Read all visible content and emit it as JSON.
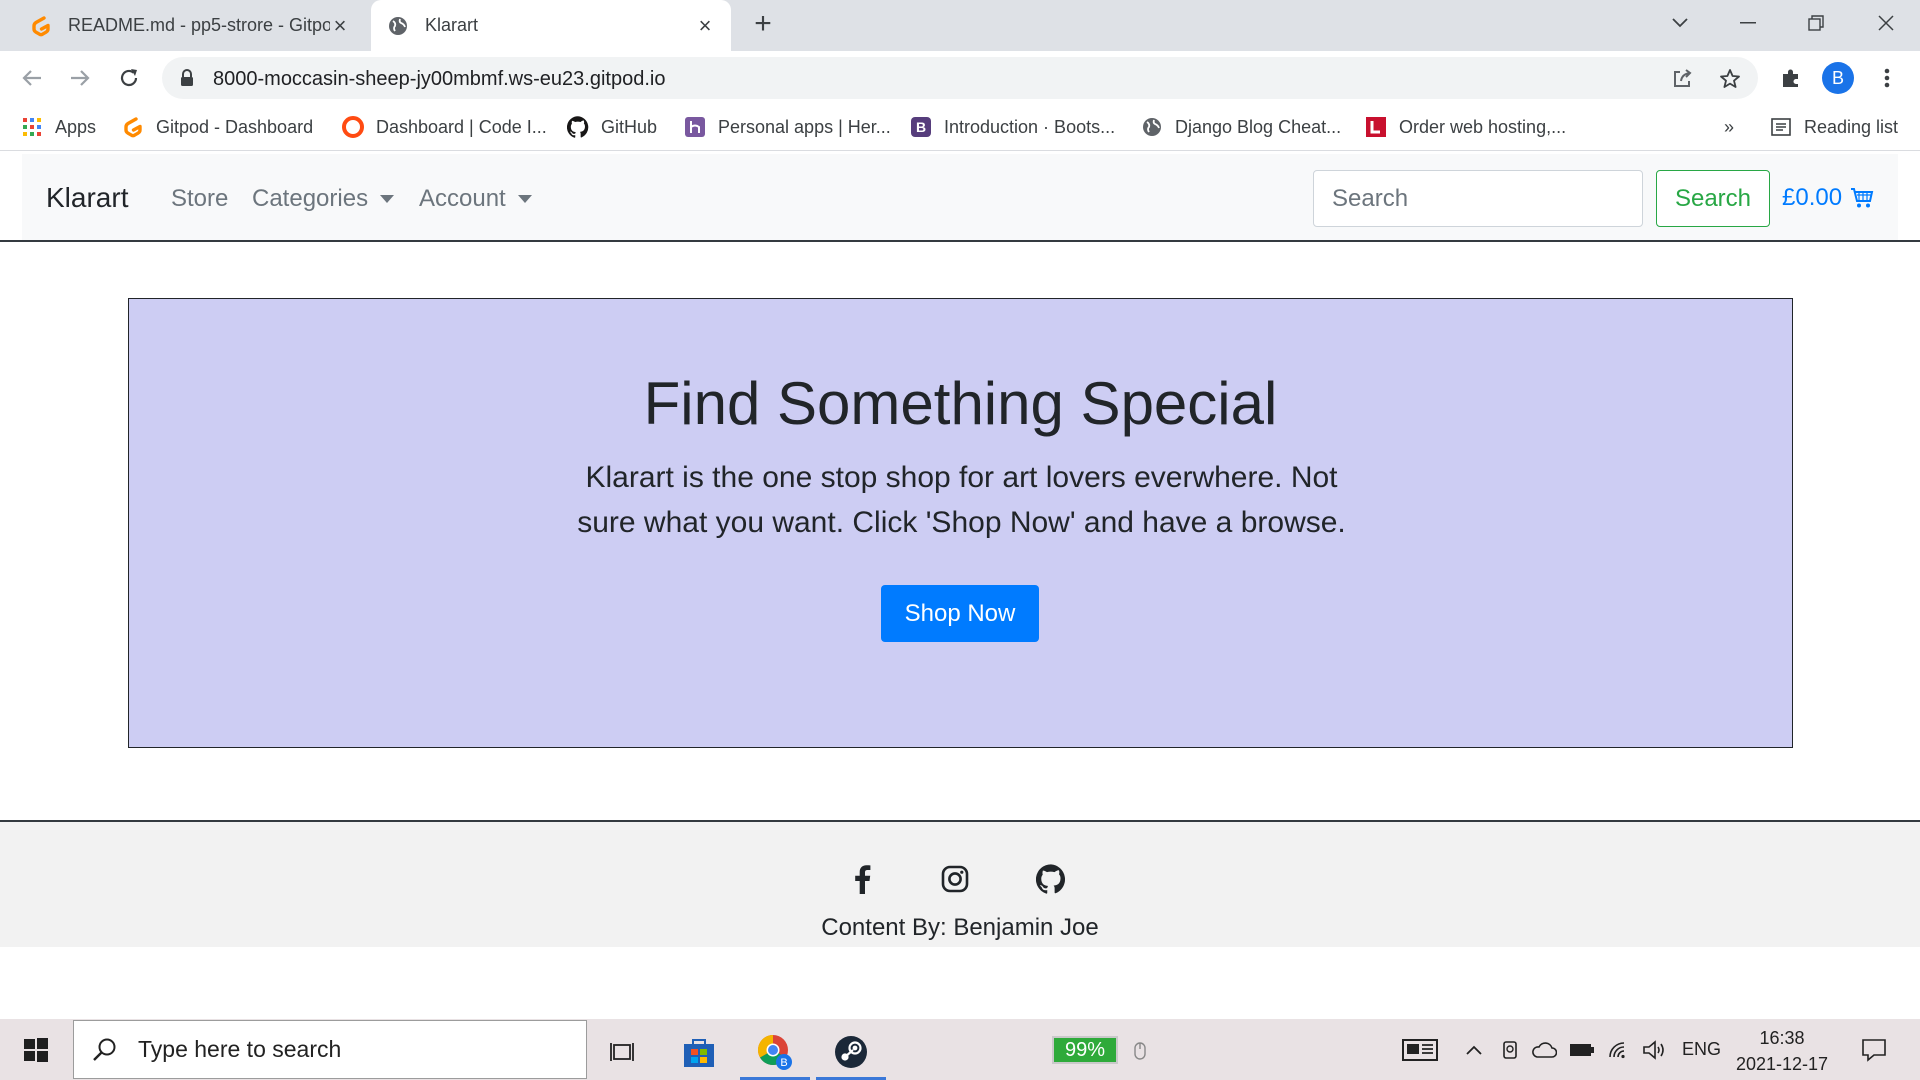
{
  "browser": {
    "tabs": [
      {
        "title": "README.md - pp5-strore - Gitpo",
        "active": false
      },
      {
        "title": "Klarart",
        "active": true
      }
    ],
    "url": "8000-moccasin-sheep-jy00mbmf.ws-eu23.gitpod.io",
    "profile_initial": "B",
    "bookmarks": [
      {
        "label": "Apps",
        "icon": "apps-grid-icon"
      },
      {
        "label": "Gitpod - Dashboard",
        "icon": "gitpod-icon"
      },
      {
        "label": "Dashboard | Code I...",
        "icon": "code-institute-icon"
      },
      {
        "label": "GitHub",
        "icon": "github-icon"
      },
      {
        "label": "Personal apps | Her...",
        "icon": "heroku-icon"
      },
      {
        "label": "Introduction · Boots...",
        "icon": "bootstrap-icon"
      },
      {
        "label": "Django Blog Cheat...",
        "icon": "globe-icon"
      },
      {
        "label": "Order web hosting,...",
        "icon": "hosting-icon"
      }
    ],
    "bookmarks_overflow": "»",
    "reading_list": "Reading list"
  },
  "site": {
    "brand": "Klarart",
    "nav": {
      "store": "Store",
      "categories": "Categories",
      "account": "Account"
    },
    "search_placeholder": "Search",
    "search_button": "Search",
    "cart_total": "£0.00",
    "hero": {
      "title": "Find Something Special",
      "text": "Klarart is the one stop shop for art lovers everwhere. Not sure what you want. Click 'Shop Now' and have a browse.",
      "button": "Shop Now"
    },
    "footer": {
      "social": [
        "facebook-icon",
        "instagram-icon",
        "github-icon"
      ],
      "credit": "Content By: Benjamin Joe"
    }
  },
  "taskbar": {
    "search_placeholder": "Type here to search",
    "battery": "99%",
    "language": "ENG",
    "time": "16:38",
    "date": "2021-12-17"
  },
  "colors": {
    "hero_bg": "#cdcdf3",
    "primary": "#007bff",
    "success": "#28a745"
  }
}
